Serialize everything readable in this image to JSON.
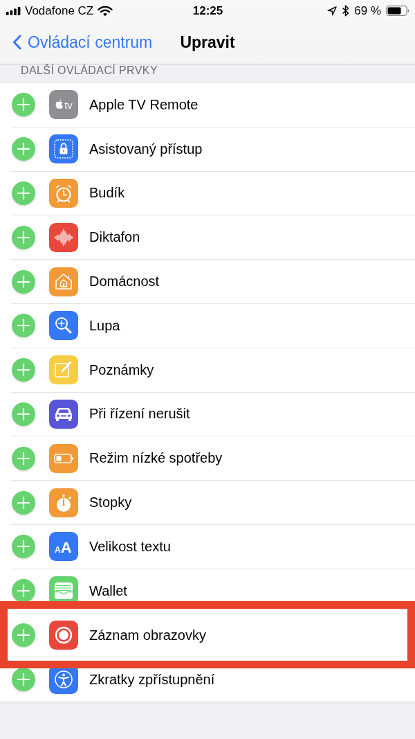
{
  "status_bar": {
    "carrier": "Vodafone CZ",
    "time": "12:25",
    "battery_percent": "69 %"
  },
  "nav_bar": {
    "back_label": "Ovládací centrum",
    "title": "Upravit"
  },
  "section": {
    "header": "DALŠÍ OVLÁDACÍ PRVKY",
    "controls": [
      {
        "label": "Apple TV Remote",
        "kind": "tv",
        "icon_text": "tv",
        "color": "#8e8e93",
        "highlighted": false
      },
      {
        "label": "Asistovaný přístup",
        "kind": "lock",
        "color": "#3478f6",
        "highlighted": false
      },
      {
        "label": "Budík",
        "kind": "alarm",
        "color": "#f19a37",
        "highlighted": false
      },
      {
        "label": "Diktafon",
        "kind": "waveform",
        "color": "#e9473c",
        "highlighted": false
      },
      {
        "label": "Domácnost",
        "kind": "home",
        "color": "#f19a37",
        "highlighted": false
      },
      {
        "label": "Lupa",
        "kind": "magnifier",
        "color": "#3478f6",
        "highlighted": false
      },
      {
        "label": "Poznámky",
        "kind": "note",
        "color": "#f7cd46",
        "highlighted": false
      },
      {
        "label": "Při řízení nerušit",
        "kind": "car",
        "color": "#5856d6",
        "highlighted": false
      },
      {
        "label": "Režim nízké spotřeby",
        "kind": "battery",
        "color": "#f19a37",
        "highlighted": false
      },
      {
        "label": "Stopky",
        "kind": "stopwatch",
        "color": "#f19a37",
        "highlighted": false
      },
      {
        "label": "Velikost textu",
        "kind": "textsize",
        "icon_text": "AA",
        "color": "#3478f6",
        "highlighted": false
      },
      {
        "label": "Wallet",
        "kind": "wallet",
        "color": "#65d46e",
        "highlighted": false
      },
      {
        "label": "Záznam obrazovky",
        "kind": "record",
        "color": "#e9473c",
        "highlighted": true
      },
      {
        "label": "Zkratky zpřístupnění",
        "kind": "accessibility",
        "color": "#3478f6",
        "highlighted": false
      }
    ]
  }
}
